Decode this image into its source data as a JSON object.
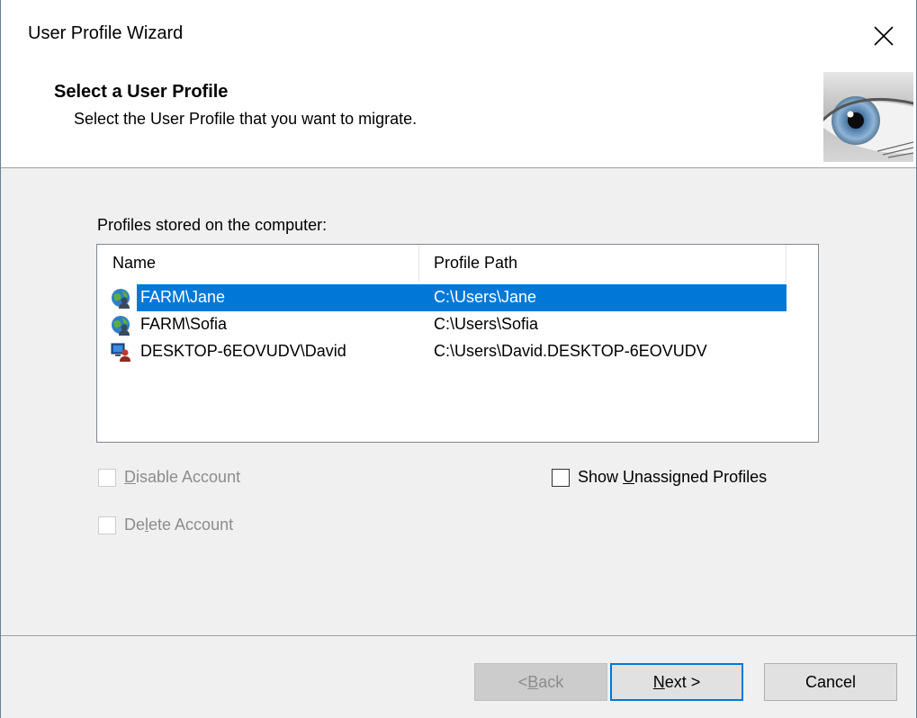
{
  "window": {
    "title": "User Profile Wizard"
  },
  "header": {
    "title": "Select a User Profile",
    "subtitle": "Select the User Profile that you want to migrate."
  },
  "profiles": {
    "label": "Profiles stored on the computer:",
    "columns": [
      "Name",
      "Profile Path"
    ],
    "rows": [
      {
        "name": "FARM\\Jane",
        "path": "C:\\Users\\Jane",
        "icon": "domain-user-icon",
        "selected": true
      },
      {
        "name": "FARM\\Sofia",
        "path": "C:\\Users\\Sofia",
        "icon": "domain-user-icon",
        "selected": false
      },
      {
        "name": "DESKTOP-6EOVUDV\\David",
        "path": "C:\\Users\\David.DESKTOP-6EOVUDV",
        "icon": "local-user-icon",
        "selected": false
      }
    ]
  },
  "options": {
    "disable_account": {
      "pre": "",
      "u": "D",
      "post": "isable Account",
      "enabled": false,
      "checked": false
    },
    "delete_account": {
      "pre": "De",
      "u": "l",
      "post": "ete Account",
      "enabled": false,
      "checked": false
    },
    "show_unassigned": {
      "pre": "Show ",
      "u": "U",
      "post": "nassigned Profiles",
      "enabled": true,
      "checked": false
    }
  },
  "buttons": {
    "back": {
      "pre": "< ",
      "u": "B",
      "post": "ack",
      "enabled": false
    },
    "next": {
      "pre": "",
      "u": "N",
      "post": "ext >",
      "enabled": true
    },
    "cancel": {
      "label": "Cancel",
      "enabled": true
    }
  },
  "colors": {
    "selection": "#0078d7",
    "dialog_bg": "#f0f0f0",
    "disabled_text": "#8c8c8c"
  }
}
